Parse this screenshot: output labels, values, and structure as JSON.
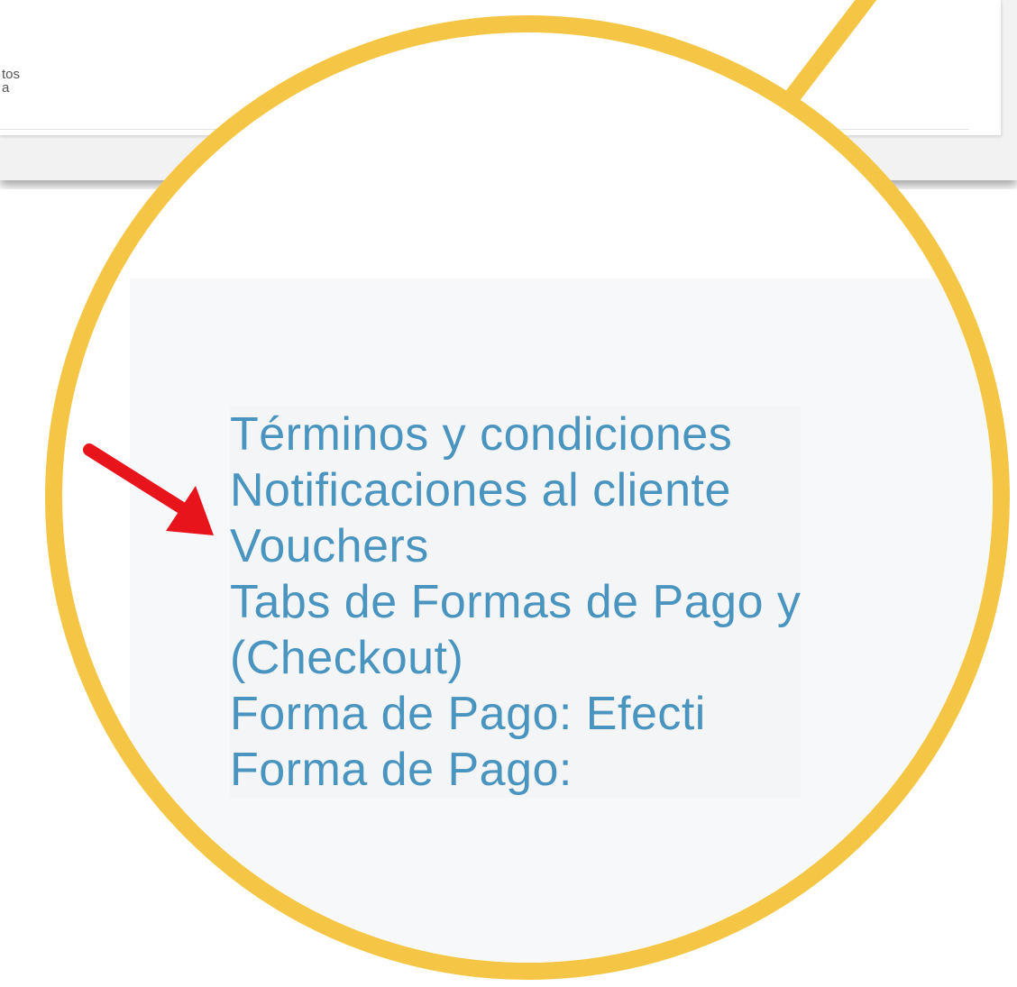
{
  "top_strip": {
    "line_1": "tos",
    "line_2": "a"
  },
  "menu": {
    "items": [
      "Términos y condiciones",
      "Notificaciones al cliente",
      "Vouchers",
      "Tabs de Formas de Pago y",
      "(Checkout)",
      "Forma de Pago: Efecti",
      "Forma de Pago:"
    ],
    "highlighted_item": "Notificaciones al cliente"
  },
  "colors": {
    "link": "#4a94c0",
    "magnifier": "#f5c645",
    "arrow": "#e8141c"
  }
}
